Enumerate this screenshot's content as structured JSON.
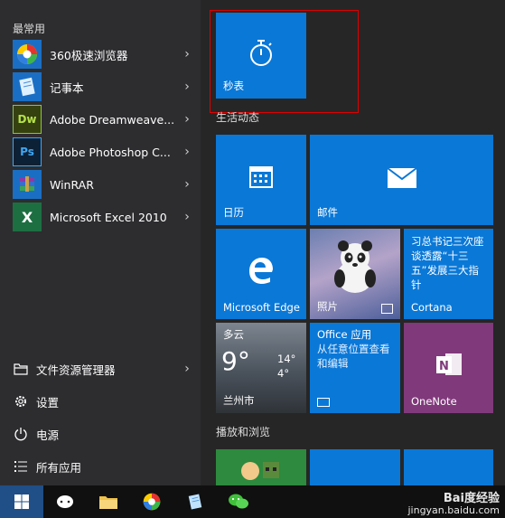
{
  "sidebar": {
    "most_used_label": "最常用",
    "apps": [
      {
        "label": "360极速浏览器",
        "icon": "360-browser-icon"
      },
      {
        "label": "记事本",
        "icon": "notepad-icon"
      },
      {
        "label": "Adobe Dreamweave...",
        "icon": "dreamweaver-icon",
        "icon_text": "Dw"
      },
      {
        "label": "Adobe Photoshop C...",
        "icon": "photoshop-icon",
        "icon_text": "Ps"
      },
      {
        "label": "WinRAR",
        "icon": "winrar-icon"
      },
      {
        "label": "Microsoft Excel 2010",
        "icon": "excel-icon",
        "icon_text": "X"
      }
    ],
    "system": [
      {
        "label": "文件资源管理器",
        "icon": "file-explorer-icon"
      },
      {
        "label": "设置",
        "icon": "gear-icon"
      },
      {
        "label": "电源",
        "icon": "power-icon"
      },
      {
        "label": "所有应用",
        "icon": "all-apps-icon"
      }
    ]
  },
  "tiles": {
    "stopwatch": "秒表",
    "section_life": "生活动态",
    "calendar": "日历",
    "mail": "邮件",
    "edge": "Microsoft Edge",
    "photos": "照片",
    "cortana_text": "习总书记三次座谈透露“十三五”发展三大指针",
    "cortana": "Cortana",
    "weather": {
      "condition": "多云",
      "temp": "9°",
      "high": "14°",
      "low": "4°",
      "city": "兰州市"
    },
    "office_title": "Office 应用",
    "office_desc": "从任意位置查看和编辑",
    "onenote": "OneNote",
    "section_play": "播放和浏览"
  },
  "watermark": {
    "brand": "Bai度经验",
    "url": "jingyan.baidu.com"
  },
  "colors": {
    "tile_blue": "#0a78d7",
    "onenote_purple": "#80397b",
    "highlight": "#e00000"
  }
}
